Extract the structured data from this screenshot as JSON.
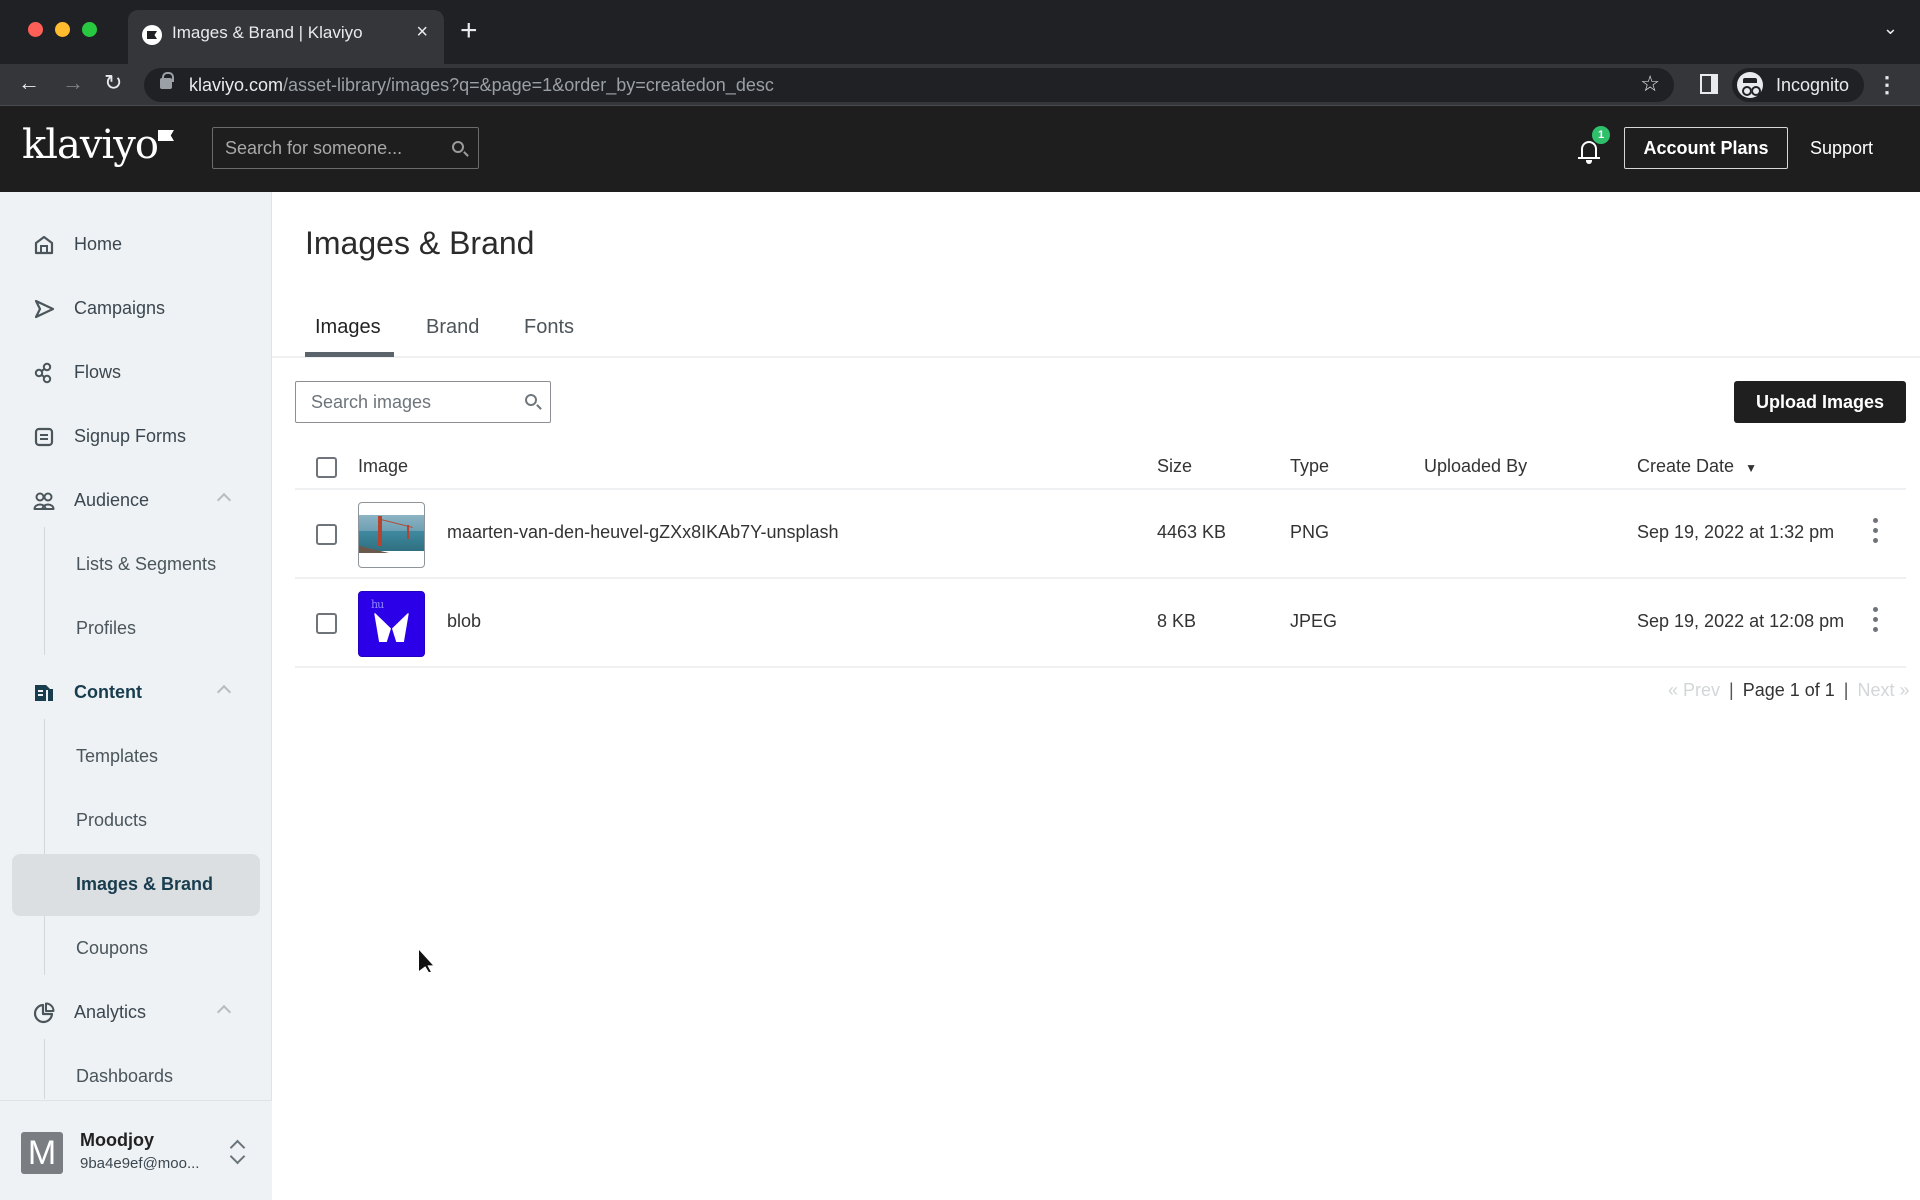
{
  "browser": {
    "tab_title": "Images & Brand | Klaviyo",
    "url_host": "klaviyo.com",
    "url_path": "/asset-library/images?q=&page=1&order_by=createdon_desc",
    "profile_label": "Incognito"
  },
  "header": {
    "logo_text": "klaviyo",
    "search_placeholder": "Search for someone...",
    "notification_count": "1",
    "account_plans_label": "Account Plans",
    "support_label": "Support"
  },
  "sidebar": {
    "items": [
      {
        "label": "Home",
        "icon": "home-icon"
      },
      {
        "label": "Campaigns",
        "icon": "send-icon"
      },
      {
        "label": "Flows",
        "icon": "flows-icon"
      },
      {
        "label": "Signup Forms",
        "icon": "form-icon"
      },
      {
        "label": "Audience",
        "icon": "people-icon",
        "expanded": true,
        "children": [
          {
            "label": "Lists & Segments"
          },
          {
            "label": "Profiles"
          }
        ]
      },
      {
        "label": "Content",
        "icon": "content-icon",
        "expanded": true,
        "active": true,
        "children": [
          {
            "label": "Templates"
          },
          {
            "label": "Products"
          },
          {
            "label": "Images & Brand",
            "selected": true
          },
          {
            "label": "Coupons"
          }
        ]
      },
      {
        "label": "Analytics",
        "icon": "analytics-icon",
        "expanded": true,
        "children": [
          {
            "label": "Dashboards"
          }
        ]
      }
    ],
    "account": {
      "avatar_letter": "M",
      "name": "Moodjoy",
      "email": "9ba4e9ef@moo..."
    }
  },
  "main": {
    "title": "Images & Brand",
    "tabs": [
      {
        "label": "Images",
        "active": true
      },
      {
        "label": "Brand"
      },
      {
        "label": "Fonts"
      }
    ],
    "search_placeholder": "Search images",
    "upload_label": "Upload Images",
    "table": {
      "columns": [
        "Image",
        "Size",
        "Type",
        "Uploaded By",
        "Create Date"
      ],
      "sort_column": "Create Date",
      "sort_direction": "desc",
      "rows": [
        {
          "name": "maarten-van-den-heuvel-gZXx8IKAb7Y-unsplash",
          "size": "4463 KB",
          "type": "PNG",
          "uploaded_by": "",
          "create_date": "Sep 19, 2022 at 1:32 pm",
          "thumbnail": "bridge-photo"
        },
        {
          "name": "blob",
          "size": "8 KB",
          "type": "JPEG",
          "uploaded_by": "",
          "create_date": "Sep 19, 2022 at 12:08 pm",
          "thumbnail": "purple-logo"
        }
      ]
    },
    "pagination": {
      "prev_label": "« Prev",
      "page_label": "Page 1 of 1",
      "next_label": "Next »"
    }
  },
  "colors": {
    "header_bg": "#1e1e1e",
    "sidebar_bg": "#eff2f4",
    "active_nav": "#183d4f",
    "badge_green": "#2fc06b",
    "primary_button": "#1f1f1f"
  }
}
